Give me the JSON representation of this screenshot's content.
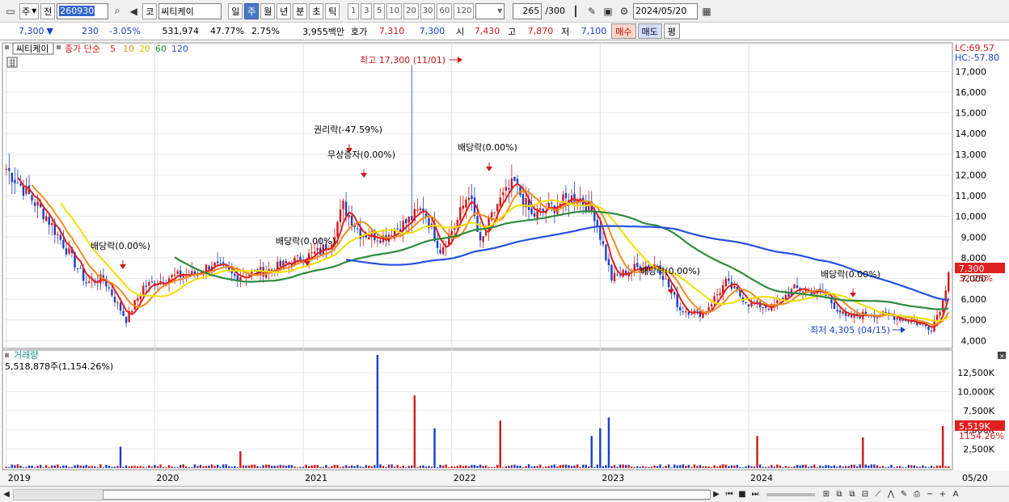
{
  "toolbar": {
    "period_selector": "주",
    "prev_label": "전",
    "code": "260930",
    "market_label": "코",
    "stock_name": "씨티케이",
    "period_tabs": [
      "일",
      "주",
      "월",
      "년",
      "분",
      "초",
      "틱"
    ],
    "active_period": "주",
    "minute_options": [
      "1",
      "3",
      "5",
      "10",
      "20",
      "30",
      "60",
      "120"
    ],
    "count": "265",
    "count_total": "/300",
    "date": "2024/05/20"
  },
  "quote": {
    "price": "7,300",
    "change": "230",
    "change_rate": "-3.05%",
    "volume": "531,974",
    "vol_ratio": "47.77%",
    "turnover": "2.75%",
    "amount": "3,955백만",
    "ask_label": "호가",
    "ask": "7,310",
    "bid": "7,300",
    "open_label": "시",
    "open": "7,430",
    "high_label": "고",
    "high": "7,870",
    "low_label": "저",
    "low": "7,100",
    "buy_label": "매수",
    "sell_label": "매도",
    "eval_label": "평"
  },
  "price_panel": {
    "name": "씨티케이",
    "legend_prefix": "종가 단순",
    "ma_periods": [
      "5",
      "10",
      "20",
      "60",
      "120"
    ],
    "lc": "LC:69.57",
    "hc": "HC:-57.80",
    "current_price_label": "7,300",
    "current_change_label": "32.25%",
    "annotations": {
      "high": "최고 17,300 (11/01)",
      "low": "최저 4,305 (04/15)",
      "rights1": "권리락(-47.59%)",
      "bonus": "무상증자(0.00%)",
      "div1": "배당락(0.00%)",
      "div2": "배당락(0.00%)",
      "div3": "배당락(0.00%)",
      "div4": "배당락(0.00%)",
      "div5": "배당락(0.00%)"
    }
  },
  "volume_panel": {
    "name": "거래량",
    "summary": "5,518,878주(1,154.26%)",
    "current_label": "5,519K",
    "current_rate": "1154.26%"
  },
  "colors": {
    "up": "#d01818",
    "down": "#1a3fc8",
    "ma5": "#e02020",
    "ma10": "#f08c1e",
    "ma20": "#f0e000",
    "ma60": "#2e8b3e",
    "ma120": "#2850e0"
  },
  "chart_data": {
    "type": "candlestick",
    "x_labels": [
      "2019",
      "2020",
      "2021",
      "2022",
      "2023",
      "2024",
      "05/20"
    ],
    "price_axis": [
      "4,000",
      "5,000",
      "6,000",
      "7,000",
      "8,000",
      "9,000",
      "10,000",
      "11,000",
      "12,000",
      "13,000",
      "14,000",
      "15,000",
      "16,000",
      "17,000"
    ],
    "volume_axis": [
      "2,500K",
      "5,000K",
      "7,500K",
      "10,000K",
      "12,500K"
    ],
    "ylim": [
      3700,
      17600
    ],
    "vol_ylim": [
      0,
      14800
    ],
    "close_keypoints": [
      [
        0,
        12300
      ],
      [
        8,
        11000
      ],
      [
        14,
        10000
      ],
      [
        22,
        8200
      ],
      [
        28,
        6800
      ],
      [
        34,
        7000
      ],
      [
        42,
        5000
      ],
      [
        48,
        6600
      ],
      [
        58,
        7100
      ],
      [
        66,
        7200
      ],
      [
        72,
        7700
      ],
      [
        80,
        7100
      ],
      [
        92,
        7400
      ],
      [
        104,
        8000
      ],
      [
        110,
        8300
      ],
      [
        114,
        8900
      ],
      [
        118,
        10500
      ],
      [
        124,
        9200
      ],
      [
        132,
        9000
      ],
      [
        140,
        9700
      ],
      [
        146,
        10400
      ],
      [
        152,
        8400
      ],
      [
        158,
        9800
      ],
      [
        162,
        11200
      ],
      [
        166,
        8600
      ],
      [
        172,
        10600
      ],
      [
        178,
        11600
      ],
      [
        184,
        10000
      ],
      [
        192,
        10500
      ],
      [
        200,
        11000
      ],
      [
        206,
        10100
      ],
      [
        212,
        7000
      ],
      [
        220,
        7500
      ],
      [
        228,
        7700
      ],
      [
        236,
        5500
      ],
      [
        244,
        5300
      ],
      [
        252,
        6800
      ],
      [
        260,
        5800
      ],
      [
        268,
        5600
      ],
      [
        276,
        6500
      ],
      [
        286,
        6300
      ],
      [
        294,
        5100
      ],
      [
        302,
        5300
      ],
      [
        310,
        5200
      ],
      [
        318,
        4900
      ],
      [
        324,
        4600
      ],
      [
        328,
        5900
      ],
      [
        330,
        7300
      ]
    ],
    "ma_series": [
      "5",
      "10",
      "20",
      "60",
      "120"
    ],
    "vol_spikes": [
      [
        40,
        2800
      ],
      [
        82,
        2200
      ],
      [
        130,
        14800
      ],
      [
        143,
        9500
      ],
      [
        150,
        5200
      ],
      [
        173,
        6200
      ],
      [
        205,
        4200
      ],
      [
        208,
        5200
      ],
      [
        211,
        6600
      ],
      [
        263,
        4200
      ],
      [
        300,
        4000
      ],
      [
        328,
        5519
      ]
    ]
  }
}
